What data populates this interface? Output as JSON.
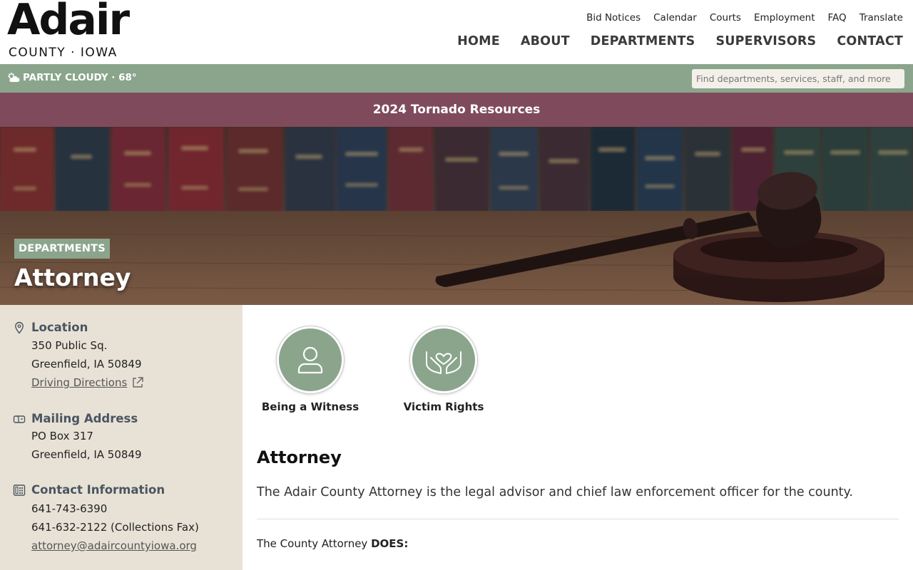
{
  "logo": {
    "word": "Adair",
    "sub": "COUNTY · IOWA"
  },
  "util_nav": [
    "Bid Notices",
    "Calendar",
    "Courts",
    "Employment",
    "FAQ",
    "Translate"
  ],
  "main_nav": [
    "HOME",
    "ABOUT",
    "DEPARTMENTS",
    "SUPERVISORS",
    "CONTACT"
  ],
  "weather": {
    "text": "PARTLY CLOUDY · 68°",
    "icon": "partly-cloudy-icon"
  },
  "search": {
    "placeholder": "Find departments, services, staff, and more"
  },
  "alert": {
    "label": "2024 Tornado Resources"
  },
  "hero": {
    "tag": "DEPARTMENTS",
    "title": "Attorney"
  },
  "sidebar": {
    "location": {
      "heading": "Location",
      "line1": "350 Public Sq.",
      "line2": "Greenfield, IA 50849",
      "link": "Driving Directions"
    },
    "mailing": {
      "heading": "Mailing Address",
      "line1": "PO Box 317",
      "line2": "Greenfield, IA 50849"
    },
    "contact": {
      "heading": "Contact Information",
      "phone": "641-743-6390",
      "fax": "641-632-2122 (Collections Fax)",
      "email": "attorney@adaircountyiowa.org"
    }
  },
  "tiles": [
    {
      "label": "Being a Witness",
      "icon": "person-icon"
    },
    {
      "label": "Victim Rights",
      "icon": "hands-heart-icon"
    }
  ],
  "main": {
    "title": "Attorney",
    "lead": "The Adair County Attorney is the legal advisor and chief law enforcement officer for the county.",
    "does_prefix": "The County Attorney ",
    "does_bold": "DOES:"
  },
  "colors": {
    "sage": "#8aa58c",
    "maroon": "#7f4b5c",
    "sidebar": "#e8e2d6"
  }
}
